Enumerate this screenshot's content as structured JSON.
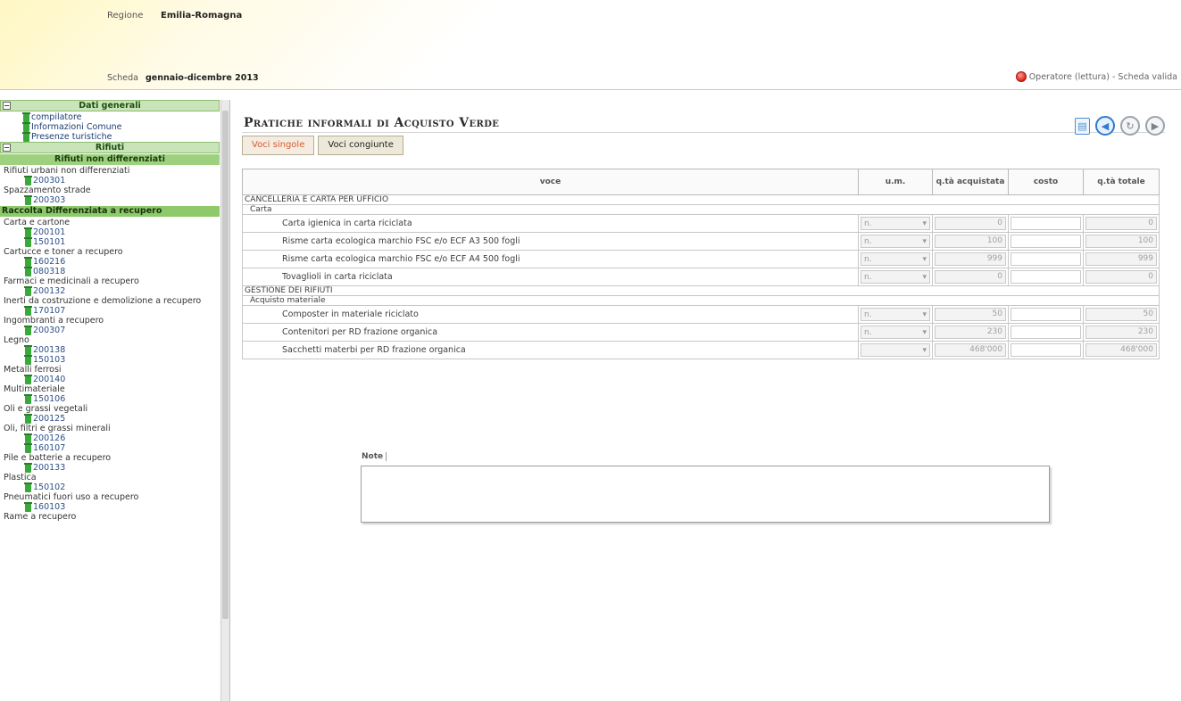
{
  "header": {
    "region_label": "Regione",
    "region_value": "Emilia-Romagna",
    "scheda_label": "Scheda",
    "scheda_value": "gennaio-dicembre 2013",
    "status": "Operatore (lettura) - Scheda valida"
  },
  "sidebar": {
    "dati_generali": "Dati generali",
    "dati_items": [
      "compilatore",
      "Informazioni Comune",
      "Presenze turistiche"
    ],
    "rifiuti": "Rifiuti",
    "rifiuti_non_diff": "Rifiuti non differenziati",
    "raccolta_label": "Raccolta Differenziata a recupero",
    "groups_a": [
      {
        "label": "Rifiuti urbani non differenziati",
        "codes": [
          "200301"
        ]
      },
      {
        "label": "Spazzamento strade",
        "codes": [
          "200303"
        ]
      }
    ],
    "groups_b": [
      {
        "label": "Carta e cartone",
        "codes": [
          "200101",
          "150101"
        ]
      },
      {
        "label": "Cartucce e toner a recupero",
        "codes": [
          "160216",
          "080318"
        ]
      },
      {
        "label": "Farmaci e medicinali a recupero",
        "codes": [
          "200132"
        ]
      },
      {
        "label": "Inerti da costruzione e demolizione a recupero",
        "codes": [
          "170107"
        ]
      },
      {
        "label": "Ingombranti a recupero",
        "codes": [
          "200307"
        ]
      },
      {
        "label": "Legno",
        "codes": [
          "200138",
          "150103"
        ]
      },
      {
        "label": "Metalli ferrosi",
        "codes": [
          "200140"
        ]
      },
      {
        "label": "Multimateriale",
        "codes": [
          "150106"
        ]
      },
      {
        "label": "Oli e grassi vegetali",
        "codes": [
          "200125"
        ]
      },
      {
        "label": "Oli, filtri e grassi minerali",
        "codes": [
          "200126",
          "160107"
        ]
      },
      {
        "label": "Pile e batterie a recupero",
        "codes": [
          "200133"
        ]
      },
      {
        "label": "Plastica",
        "codes": [
          "150102"
        ]
      },
      {
        "label": "Pneumatici fuori uso a recupero",
        "codes": [
          "160103"
        ]
      },
      {
        "label": "Rame a recupero",
        "codes": []
      }
    ]
  },
  "main": {
    "title": "Pratiche informali di Acquisto Verde",
    "tab_single": "Voci singole",
    "tab_joined": "Voci congiunte",
    "columns": [
      "voce",
      "u.m.",
      "q.tà acquistata",
      "costo",
      "q.tà totale"
    ],
    "cat1": "CANCELLERIA E CARTA PER UFFICIO",
    "sub1": "Carta",
    "cat2": "GESTIONE DEI RIFIUTI",
    "sub2": "Acquisto materiale",
    "rows1": [
      {
        "voce": "Carta igienica in carta riciclata",
        "um": "n.",
        "qta": "0",
        "costo": "",
        "totale": "0"
      },
      {
        "voce": "Risme carta ecologica marchio FSC e/o ECF A3 500 fogli",
        "um": "n.",
        "qta": "100",
        "costo": "",
        "totale": "100"
      },
      {
        "voce": "Risme carta ecologica marchio FSC e/o ECF A4 500 fogli",
        "um": "n.",
        "qta": "999",
        "costo": "",
        "totale": "999"
      },
      {
        "voce": "Tovaglioli in carta riciclata",
        "um": "n.",
        "qta": "0",
        "costo": "",
        "totale": "0"
      }
    ],
    "rows2": [
      {
        "voce": "Composter in materiale riciclato",
        "um": "n.",
        "qta": "50",
        "costo": "",
        "totale": "50"
      },
      {
        "voce": "Contenitori per RD frazione organica",
        "um": "n.",
        "qta": "230",
        "costo": "",
        "totale": "230"
      },
      {
        "voce": "Sacchetti materbi per RD frazione organica",
        "um": "",
        "qta": "468'000",
        "costo": "",
        "totale": "468'000"
      }
    ],
    "note_label": "Note"
  }
}
